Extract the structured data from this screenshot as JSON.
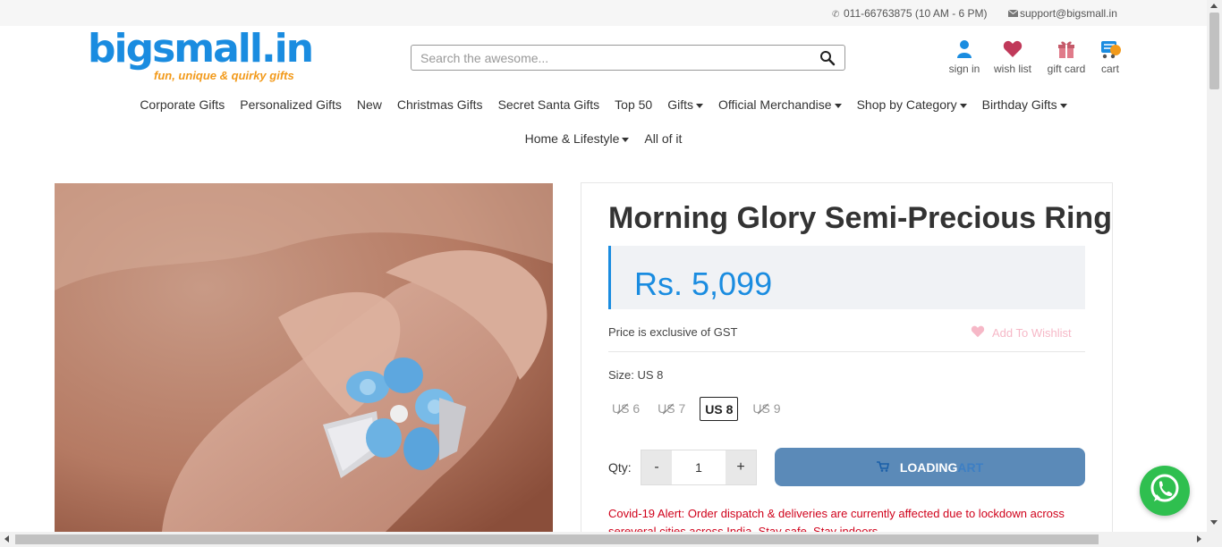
{
  "topbar": {
    "phone": "011-66763875 (10 AM - 6 PM)",
    "email": "support@bigsmall.in"
  },
  "logo": {
    "name": "bigsmall.in",
    "tagline": "fun, unique & quirky gifts"
  },
  "search": {
    "placeholder": "Search the awesome..."
  },
  "header_links": [
    {
      "label": "sign in",
      "icon": "user-icon"
    },
    {
      "label": "wish list",
      "icon": "heart-icon"
    },
    {
      "label": "gift card",
      "icon": "gift-icon"
    },
    {
      "label": "cart",
      "icon": "cart-icon"
    }
  ],
  "nav": {
    "row1": [
      {
        "label": "Corporate Gifts",
        "dropdown": false
      },
      {
        "label": "Personalized Gifts",
        "dropdown": false
      },
      {
        "label": "New",
        "dropdown": false
      },
      {
        "label": "Christmas Gifts",
        "dropdown": false
      },
      {
        "label": "Secret Santa Gifts",
        "dropdown": false
      },
      {
        "label": "Top 50",
        "dropdown": false
      },
      {
        "label": "Gifts",
        "dropdown": true
      },
      {
        "label": "Official Merchandise",
        "dropdown": true
      },
      {
        "label": "Shop by Category",
        "dropdown": true
      },
      {
        "label": "Birthday Gifts",
        "dropdown": true
      }
    ],
    "row2": [
      {
        "label": "Home & Lifestyle",
        "dropdown": true
      },
      {
        "label": "All of it",
        "dropdown": false
      }
    ]
  },
  "product": {
    "title": "Morning Glory Semi-Precious Ring",
    "price": "Rs. 5,099",
    "gst_note": "Price is exclusive of GST",
    "wishlist_label": "Add To Wishlist",
    "size_label": "Size: US 8",
    "sizes": [
      {
        "label": "US 6",
        "available": false,
        "selected": false
      },
      {
        "label": "US 7",
        "available": false,
        "selected": false
      },
      {
        "label": "US 8",
        "available": true,
        "selected": true
      },
      {
        "label": "US 9",
        "available": false,
        "selected": false
      }
    ],
    "qty_label": "Qty:",
    "qty_minus": "-",
    "qty_value": "1",
    "qty_plus": "+",
    "cart_button": "LOADING",
    "cart_button_faded": "ART",
    "covid_alert": "Covid-19 Alert: Order dispatch & deliveries are currently affected due to lockdown across sereveral cities across India. Stay safe. Stay indoors."
  },
  "colors": {
    "brand_blue": "#1a8ce0",
    "brand_orange": "#f29a1b",
    "cart_button": "#5b8ab8",
    "alert_red": "#d0021b",
    "whatsapp_green": "#2fbf4f"
  }
}
